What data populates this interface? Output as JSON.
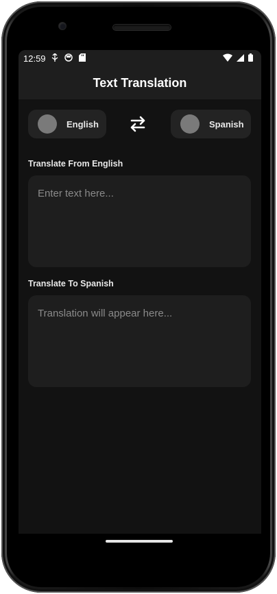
{
  "status_bar": {
    "time": "12:59"
  },
  "app_bar": {
    "title": "Text Translation"
  },
  "languages": {
    "from": "English",
    "to": "Spanish"
  },
  "input_section": {
    "label": "Translate From English",
    "placeholder": "Enter text here..."
  },
  "output_section": {
    "label": "Translate To Spanish",
    "placeholder": "Translation will appear here..."
  },
  "colors": {
    "screen_bg": "#121212",
    "surface": "#1e1e1e",
    "pill": "#232323",
    "flag_placeholder": "#7a7a7a",
    "text": "#ffffff",
    "muted_text": "#8a8a8a"
  },
  "icons": {
    "swap": "swap-horiz-icon",
    "wifi": "wifi-icon",
    "signal": "cell-signal-icon",
    "battery": "battery-icon"
  }
}
